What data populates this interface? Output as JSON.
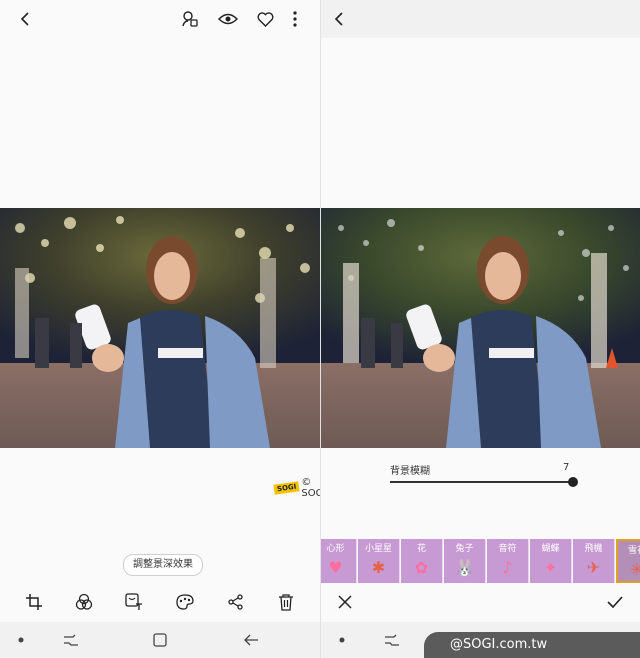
{
  "left": {
    "adjust_button_label": "調整景深效果",
    "watermark_logo": "SOGI",
    "watermark_text": "© SOGI.com.tw"
  },
  "right": {
    "slider": {
      "label": "背景模糊",
      "value": "7",
      "level_fraction": 0.7
    },
    "effects": [
      {
        "label": "心形",
        "glyph": "♥"
      },
      {
        "label": "小星星",
        "glyph": "✱"
      },
      {
        "label": "花",
        "glyph": "✿"
      },
      {
        "label": "兔子",
        "glyph": "🐰"
      },
      {
        "label": "音符",
        "glyph": "♪"
      },
      {
        "label": "蝴蝶",
        "glyph": "✦"
      },
      {
        "label": "飛機",
        "glyph": "✈"
      },
      {
        "label": "雪花",
        "glyph": "✳"
      }
    ],
    "selected_effect": "雪花"
  },
  "bottom_badge": "@SOGI.com.tw",
  "colors": {
    "effect_bg": "#c79ad4",
    "selected_border": "#e0a020",
    "accent": "#222222"
  },
  "icons": [
    "back-icon",
    "search-person-icon",
    "eye-icon",
    "heart-icon",
    "more-icon",
    "crop-icon",
    "filter-icon",
    "sticker-icon",
    "palette-icon",
    "share-icon",
    "delete-icon",
    "close-icon",
    "check-icon"
  ]
}
